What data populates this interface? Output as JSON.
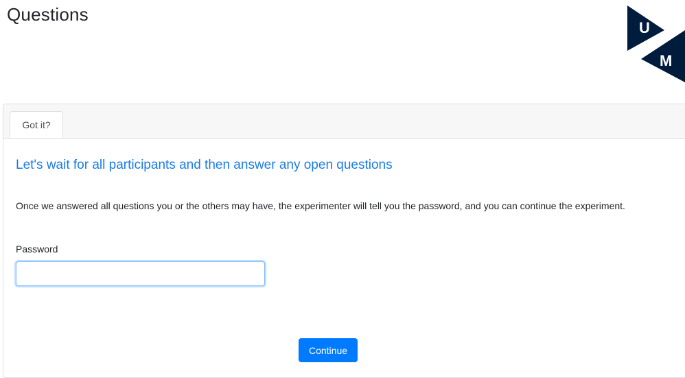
{
  "page": {
    "title": "Questions"
  },
  "logo": {
    "letter_top": "U",
    "letter_bottom": "M",
    "color": "#001c3d"
  },
  "tabs": [
    {
      "label": "Got it?"
    }
  ],
  "content": {
    "heading": "Let's wait for all participants and then answer any open questions",
    "instructions": "Once we answered all questions you or the others may have, the experimenter will tell you the password, and you can continue the experiment."
  },
  "form": {
    "password_label": "Password",
    "password_value": "",
    "continue_label": "Continue"
  },
  "colors": {
    "heading": "#1a7ce6",
    "primary_button": "#007bff"
  }
}
